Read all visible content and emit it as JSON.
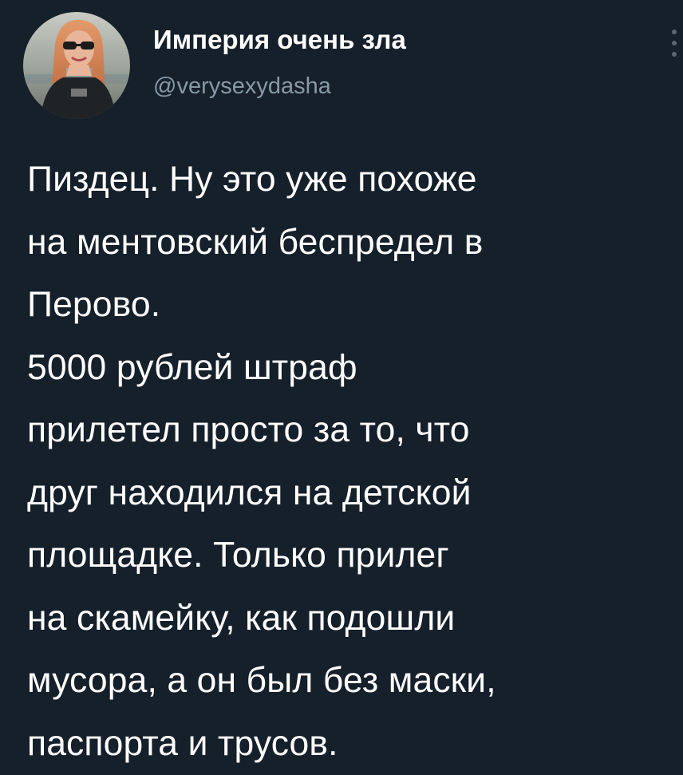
{
  "tweet": {
    "author": {
      "display_name": "Империя очень зла",
      "handle": "@verysexydasha",
      "avatar_icon": "user-avatar-photo"
    },
    "more_icon": "more-options-icon",
    "text_lines": [
      "Пиздец. Ну это уже похоже",
      "на ментовский беспредел в",
      "Перово.",
      "5000 рублей штраф",
      "прилетел просто за то, что",
      "друг находился на детской",
      "площадке. Только прилег",
      "на скамейку, как подошли",
      "мусора, а он был без маски,",
      "паспорта и трусов."
    ]
  },
  "colors": {
    "background": "#15202b",
    "text_primary": "#ffffff",
    "text_secondary": "#8899a6"
  }
}
